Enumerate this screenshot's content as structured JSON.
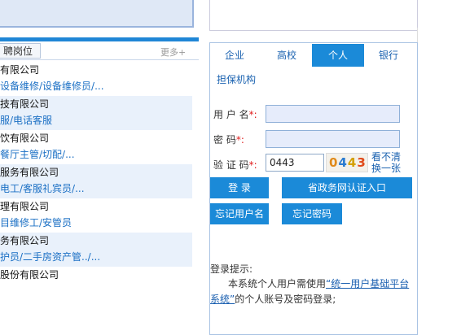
{
  "jobs_section": {
    "tab_label": "聘岗位",
    "more_label": "更多+",
    "items": [
      {
        "company": "有限公司",
        "positions": "设备维修/设备维修员/..."
      },
      {
        "company": "技有限公司",
        "positions": "服/电话客服"
      },
      {
        "company": "饮有限公司",
        "positions": "餐厅主管/切配/..."
      },
      {
        "company": "服务有限公司",
        "positions": "电工/客服礼宾员/..."
      },
      {
        "company": "理有限公司",
        "positions": "目维修工/安管员"
      },
      {
        "company": "务有限公司",
        "positions": "护员/二手房资产管../..."
      },
      {
        "company": "股份有限公司",
        "positions": ""
      }
    ]
  },
  "login": {
    "tabs": [
      "企业",
      "高校",
      "个人",
      "银行",
      "担保机构"
    ],
    "active_tab": "个人",
    "username_label": "用 户 名",
    "password_label": "密    码",
    "captcha_label": "验 证 码",
    "required_mark": "*:",
    "captcha_value": "0443",
    "captcha_image_text": "0443",
    "refresh_label": "看不清换一张",
    "refresh_line1": "看不清",
    "refresh_line2": "换一张",
    "login_button": "登    录",
    "gov_login_button": "省政务网认证入口",
    "forgot_username": "忘记用户名",
    "forgot_password": "忘记密码",
    "tip_title": "登录提示:",
    "tip_pre": "本系统个人用户需使用",
    "tip_link_1": "“统一用户基础平台",
    "tip_link_2": "系统”",
    "tip_post": "的个人账号及密码登录;"
  },
  "colors": {
    "accent": "#1b8ad8",
    "link": "#1a62b0",
    "required": "#e02020"
  }
}
